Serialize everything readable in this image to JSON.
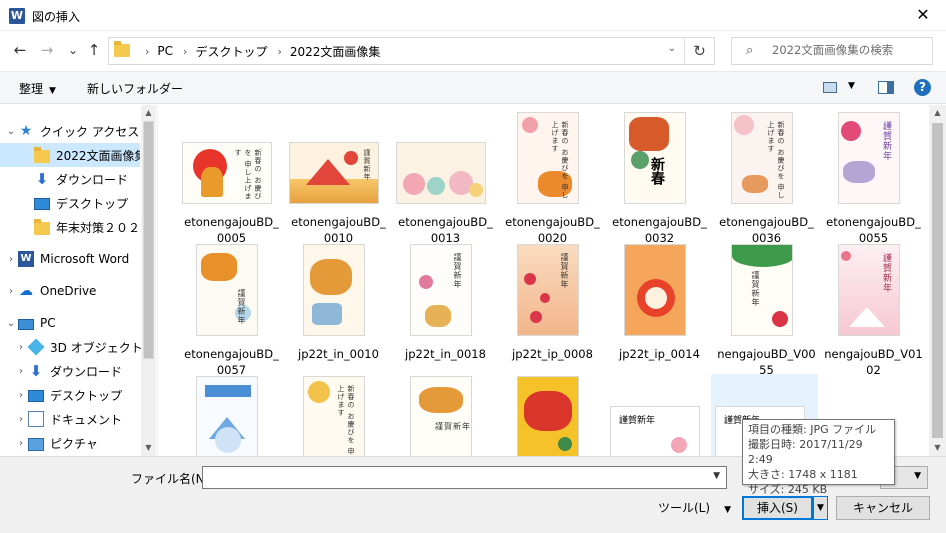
{
  "window": {
    "title": "図の挿入",
    "app_icon": "W",
    "close": "✕"
  },
  "nav": {
    "back": "←",
    "forward": "→",
    "recent": "⌄",
    "up": "↑",
    "breadcrumbs": [
      "PC",
      "デスクトップ",
      "2022文面画像集"
    ],
    "refresh": "↻",
    "search_placeholder": "2022文面画像集の検索",
    "search_icon": "⌕"
  },
  "commands": {
    "organize": "整理",
    "new_folder": "新しいフォルダー",
    "help": "?"
  },
  "sidebar": {
    "items": [
      {
        "label": "クイック アクセス",
        "icon": "star-icon",
        "chev": "⌄"
      },
      {
        "label": "2022文面画像集",
        "icon": "folder-icon",
        "selected": true
      },
      {
        "label": "ダウンロード",
        "icon": "download-icon"
      },
      {
        "label": "デスクトップ",
        "icon": "desktop-icon"
      },
      {
        "label": "年末対策２０２",
        "icon": "folder-icon"
      },
      {
        "label": "Microsoft Word",
        "icon": "word-icon",
        "chev": "›"
      },
      {
        "label": "OneDrive",
        "icon": "cloud-icon",
        "chev": "›"
      },
      {
        "label": "PC",
        "icon": "pc-icon",
        "chev": "⌄"
      },
      {
        "label": "3D オブジェクト",
        "icon": "cube-icon",
        "chev": "›"
      },
      {
        "label": "ダウンロード",
        "icon": "download-icon",
        "chev": "›"
      },
      {
        "label": "デスクトップ",
        "icon": "desktop-icon",
        "chev": "›"
      },
      {
        "label": "ドキュメント",
        "icon": "document-icon",
        "chev": "›"
      },
      {
        "label": "ピクチャ",
        "icon": "picture-icon",
        "chev": "›"
      }
    ]
  },
  "files": [
    {
      "name": [
        "etonengajouBD_",
        "0005"
      ]
    },
    {
      "name": [
        "etonengajouBD_",
        "0010"
      ]
    },
    {
      "name": [
        "etonengajouBD_",
        "0013"
      ]
    },
    {
      "name": [
        "etonengajouBD_",
        "0020"
      ]
    },
    {
      "name": [
        "etonengajouBD_",
        "0032"
      ]
    },
    {
      "name": [
        "etonengajouBD_",
        "0036"
      ]
    },
    {
      "name": [
        "etonengajouBD_",
        "0055"
      ]
    },
    {
      "name": [
        "etonengajouBD_",
        "0057"
      ]
    },
    {
      "name": [
        "jp22t_in_0010",
        ""
      ]
    },
    {
      "name": [
        "jp22t_in_0018",
        ""
      ]
    },
    {
      "name": [
        "jp22t_ip_0008",
        ""
      ]
    },
    {
      "name": [
        "jp22t_ip_0014",
        ""
      ]
    },
    {
      "name": [
        "nengajouBD_V00",
        "55"
      ]
    },
    {
      "name": [
        "nengajouBD_V01",
        "02"
      ]
    },
    {
      "name": [
        "",
        ""
      ]
    },
    {
      "name": [
        "",
        ""
      ]
    },
    {
      "name": [
        "",
        ""
      ]
    },
    {
      "name": [
        "",
        ""
      ]
    },
    {
      "name": [
        "",
        ""
      ]
    },
    {
      "name": [
        "",
        ""
      ]
    }
  ],
  "card_text": {
    "kinga": "謹賀新年",
    "shinshun": "新春",
    "greeting": "新春の お慶びを 申し上げます"
  },
  "tooltip": {
    "type": "項目の種類: JPG ファイル",
    "date": "撮影日時: 2017/11/29 2:49",
    "size_px": "大きさ: 1748 x 1181",
    "size": "サイズ: 245 KB"
  },
  "bottom": {
    "filename_label": "ファイル名(N):",
    "filename_value": "",
    "tools": "ツール(L)",
    "insert": "挿入(S)",
    "cancel": "キャンセル"
  },
  "colors": {
    "selection": "#cce8ff",
    "accent": "#0078d7",
    "hover": "#e5f3ff"
  }
}
